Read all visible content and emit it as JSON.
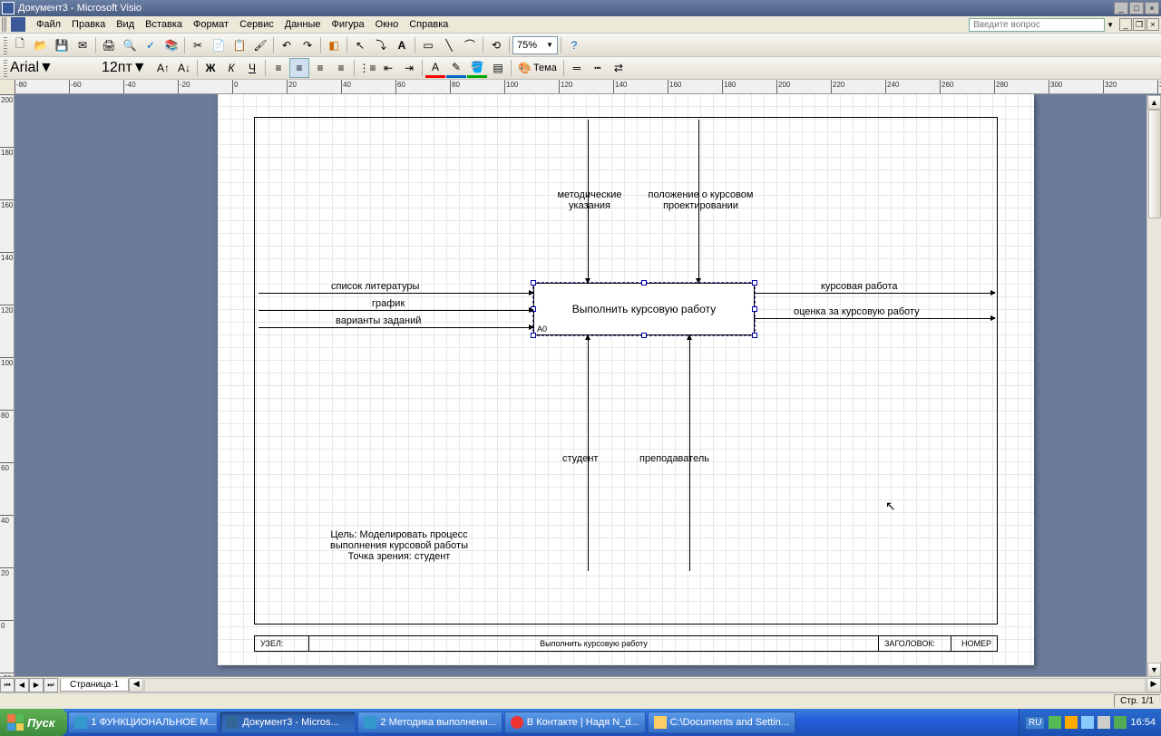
{
  "title": "Документ3 - Microsoft Visio",
  "menu": [
    "Файл",
    "Правка",
    "Вид",
    "Вставка",
    "Формат",
    "Сервис",
    "Данные",
    "Фигура",
    "Окно",
    "Справка"
  ],
  "question_prompt": "Введите вопрос",
  "font": "Arial",
  "font_size": "12пт",
  "zoom": "75%",
  "theme_label": "Тема",
  "page_tab": "Страница-1",
  "status_page": "Стр. 1/1",
  "diagram": {
    "main_box": "Выполнить курсовую работу",
    "box_code": "A0",
    "inputs": [
      "список литературы",
      "график",
      "варианты заданий"
    ],
    "controls": [
      "методические указания",
      "положение о курсовом проектировании"
    ],
    "mechanisms": [
      "студент",
      "преподаватель"
    ],
    "outputs": [
      "курсовая работа",
      "оценка за курсовую работу"
    ],
    "goal1": "Цель: Моделировать процесс",
    "goal2": "выполнения курсовой работы",
    "goal3": "Точка зрения: студент",
    "tb_node": "УЗЕЛ:",
    "tb_title": "Выполнить курсовую работу",
    "tb_header": "ЗАГОЛОВОК:",
    "tb_num": "НОМЕР"
  },
  "taskbar": {
    "start": "Пуск",
    "items": [
      "1 ФУНКЦИОНАЛЬНОЕ М...",
      "Документ3 - Micros...",
      "2 Методика выполнени...",
      "В Контакте | Надя N_d...",
      "C:\\Documents and Settin..."
    ],
    "lang": "RU",
    "time": "16:54"
  }
}
